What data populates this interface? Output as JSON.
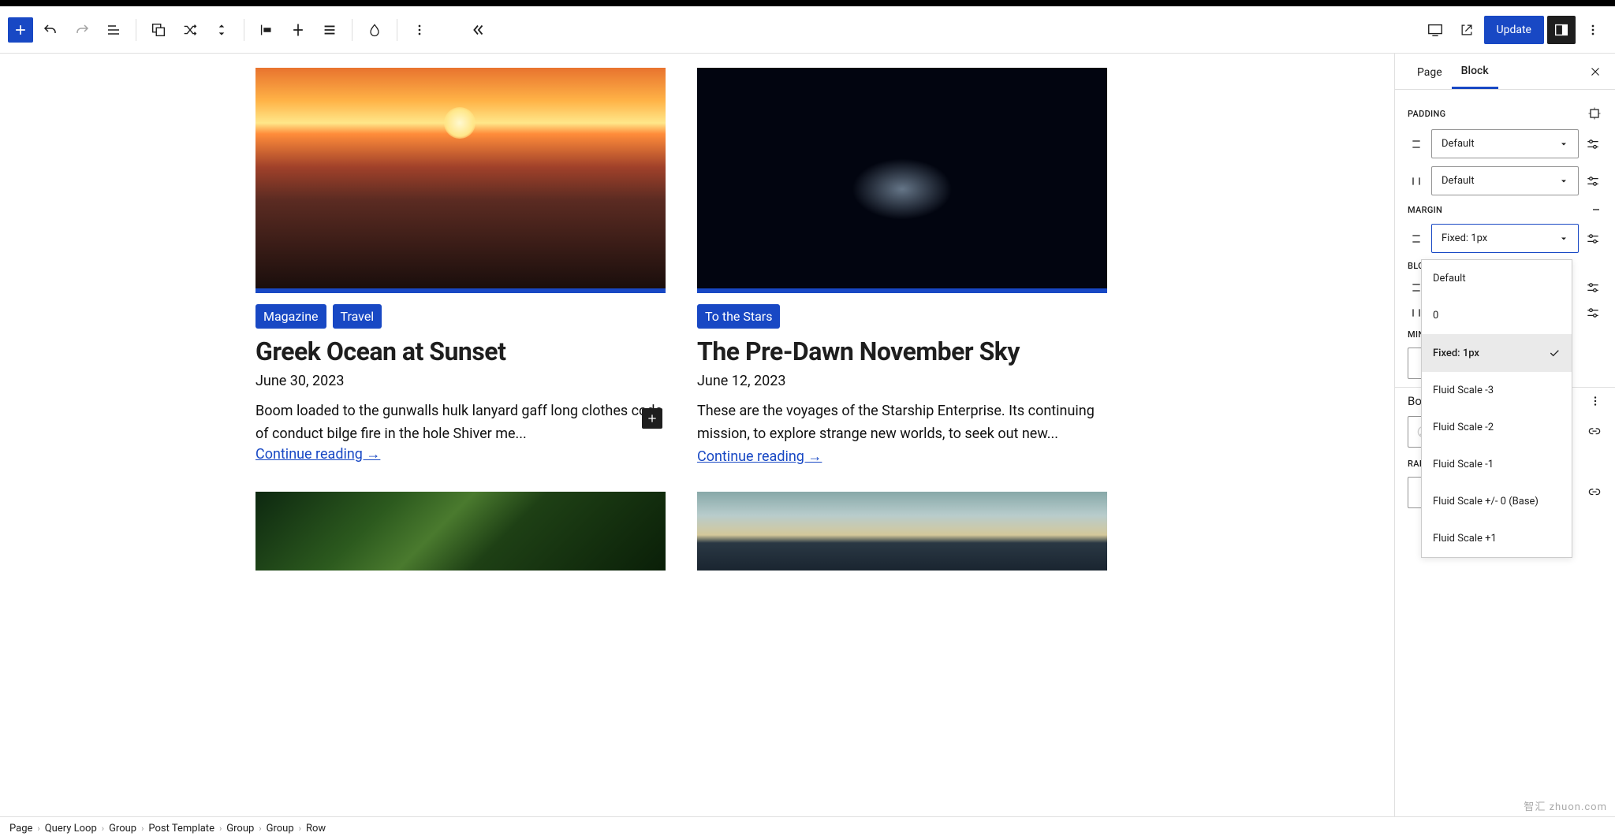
{
  "toolbar": {
    "update_label": "Update"
  },
  "posts": [
    {
      "tags": [
        "Magazine",
        "Travel"
      ],
      "title": "Greek Ocean at Sunset",
      "date": "June 30, 2023",
      "excerpt": "Boom loaded to the gunwalls hulk lanyard gaff long clothes code of conduct bilge fire in the hole Shiver me...",
      "more": "Continue reading →"
    },
    {
      "tags": [
        "To the Stars"
      ],
      "title": "The Pre-Dawn November Sky",
      "date": "June 12, 2023",
      "excerpt": "These are the voyages of the Starship Enterprise. Its continuing mission, to explore strange new worlds, to seek out new... ",
      "more": "Continue reading →"
    }
  ],
  "sidebar": {
    "tabs": {
      "page": "Page",
      "block": "Block"
    },
    "padding_label": "PADDING",
    "margin_label": "MARGIN",
    "block_label": "BLOCK",
    "minh_label": "MIN. H",
    "border_label": "Border",
    "radius_label": "RADIUS",
    "padding_v": "Default",
    "padding_h": "Default",
    "margin_v": "Fixed: 1px",
    "dropdown": {
      "default": "Default",
      "zero": "0",
      "fixed1": "Fixed: 1px",
      "fm3": "Fluid Scale -3",
      "fm2": "Fluid Scale -2",
      "fm1": "Fluid Scale -1",
      "f0": "Fluid Scale +/- 0 (Base)",
      "fp1": "Fluid Scale +1"
    }
  },
  "breadcrumbs": [
    "Page",
    "Query Loop",
    "Group",
    "Post Template",
    "Group",
    "Group",
    "Row"
  ],
  "watermark": "智汇 zhuon.com"
}
